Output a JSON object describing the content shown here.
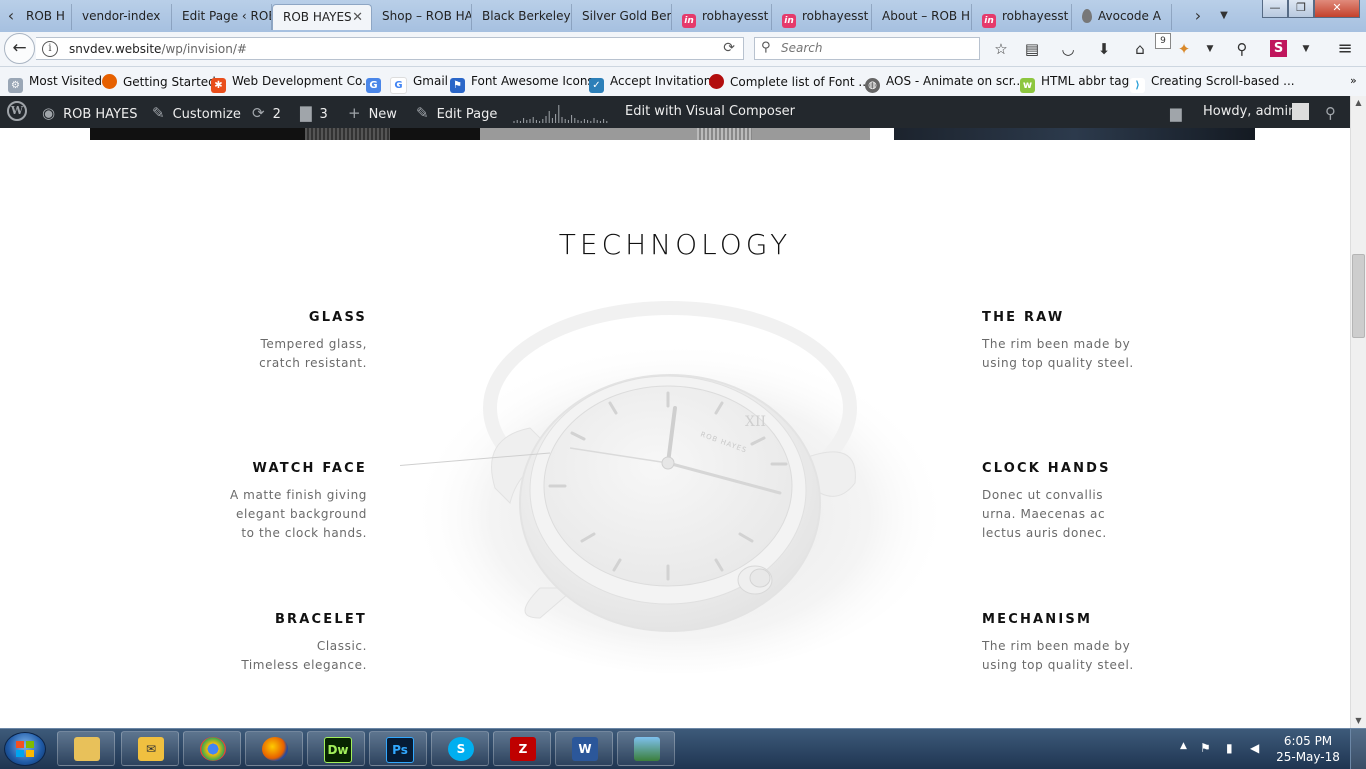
{
  "browser": {
    "tabs": [
      {
        "label": "ROB H"
      },
      {
        "label": "vendor-index"
      },
      {
        "label": "Edit Page ‹ ROB"
      },
      {
        "label": "ROB HAYES"
      },
      {
        "label": "Shop – ROB HA"
      },
      {
        "label": "Black Berkeley"
      },
      {
        "label": "Silver Gold Berk"
      },
      {
        "label": "robhayesst"
      },
      {
        "label": "robhayesst"
      },
      {
        "label": "About – ROB H"
      },
      {
        "label": "robhayesst"
      },
      {
        "label": "Avocode A"
      }
    ],
    "url_host": "snvdev.website",
    "url_path": "/wp/invision/#",
    "search_placeholder": "Search",
    "notification_count": "9",
    "bookmarks": [
      {
        "label": "Most Visited"
      },
      {
        "label": "Getting Started"
      },
      {
        "label": "Web Development Co..."
      },
      {
        "label": "Gmail"
      },
      {
        "label": "Font Awesome Icons"
      },
      {
        "label": "Accept Invitation"
      },
      {
        "label": "Complete list of Font ..."
      },
      {
        "label": "AOS - Animate on scr..."
      },
      {
        "label": "HTML abbr tag"
      },
      {
        "label": "Creating Scroll-based ..."
      }
    ]
  },
  "wp_admin_bar": {
    "site_name": "ROB HAYES",
    "customize": "Customize",
    "updates_count": "2",
    "comments_count": "3",
    "new_label": "New",
    "edit_page": "Edit Page",
    "visual_composer": "Edit with Visual Composer",
    "greeting": "Howdy, admin"
  },
  "section": {
    "title": "TECHNOLOGY",
    "features_left": [
      {
        "title": "GLASS",
        "text": "Tempered glass,\ncratch resistant."
      },
      {
        "title": "WATCH FACE",
        "text": "A matte finish giving\nelegant background\nto the clock hands."
      },
      {
        "title": "BRACELET",
        "text": "Classic.\nTimeless elegance."
      }
    ],
    "features_right": [
      {
        "title": "THE RAW",
        "text": "The rim been made by\nusing top quality steel."
      },
      {
        "title": "CLOCK HANDS",
        "text": "Donec ut convallis\nurna. Maecenas ac\nlectus auris donec."
      },
      {
        "title": "MECHANISM",
        "text": "The rim been made by\nusing top quality steel."
      }
    ],
    "watch_brand": "ROB HAYES"
  },
  "taskbar": {
    "apps": [
      "explorer",
      "outlook",
      "chrome",
      "firefox",
      "dreamweaver",
      "photoshop",
      "skype",
      "filezilla",
      "word",
      "photo-viewer"
    ],
    "dw_label": "Dw",
    "ps_label": "Ps",
    "time": "6:05 PM",
    "date": "25-May-18"
  }
}
